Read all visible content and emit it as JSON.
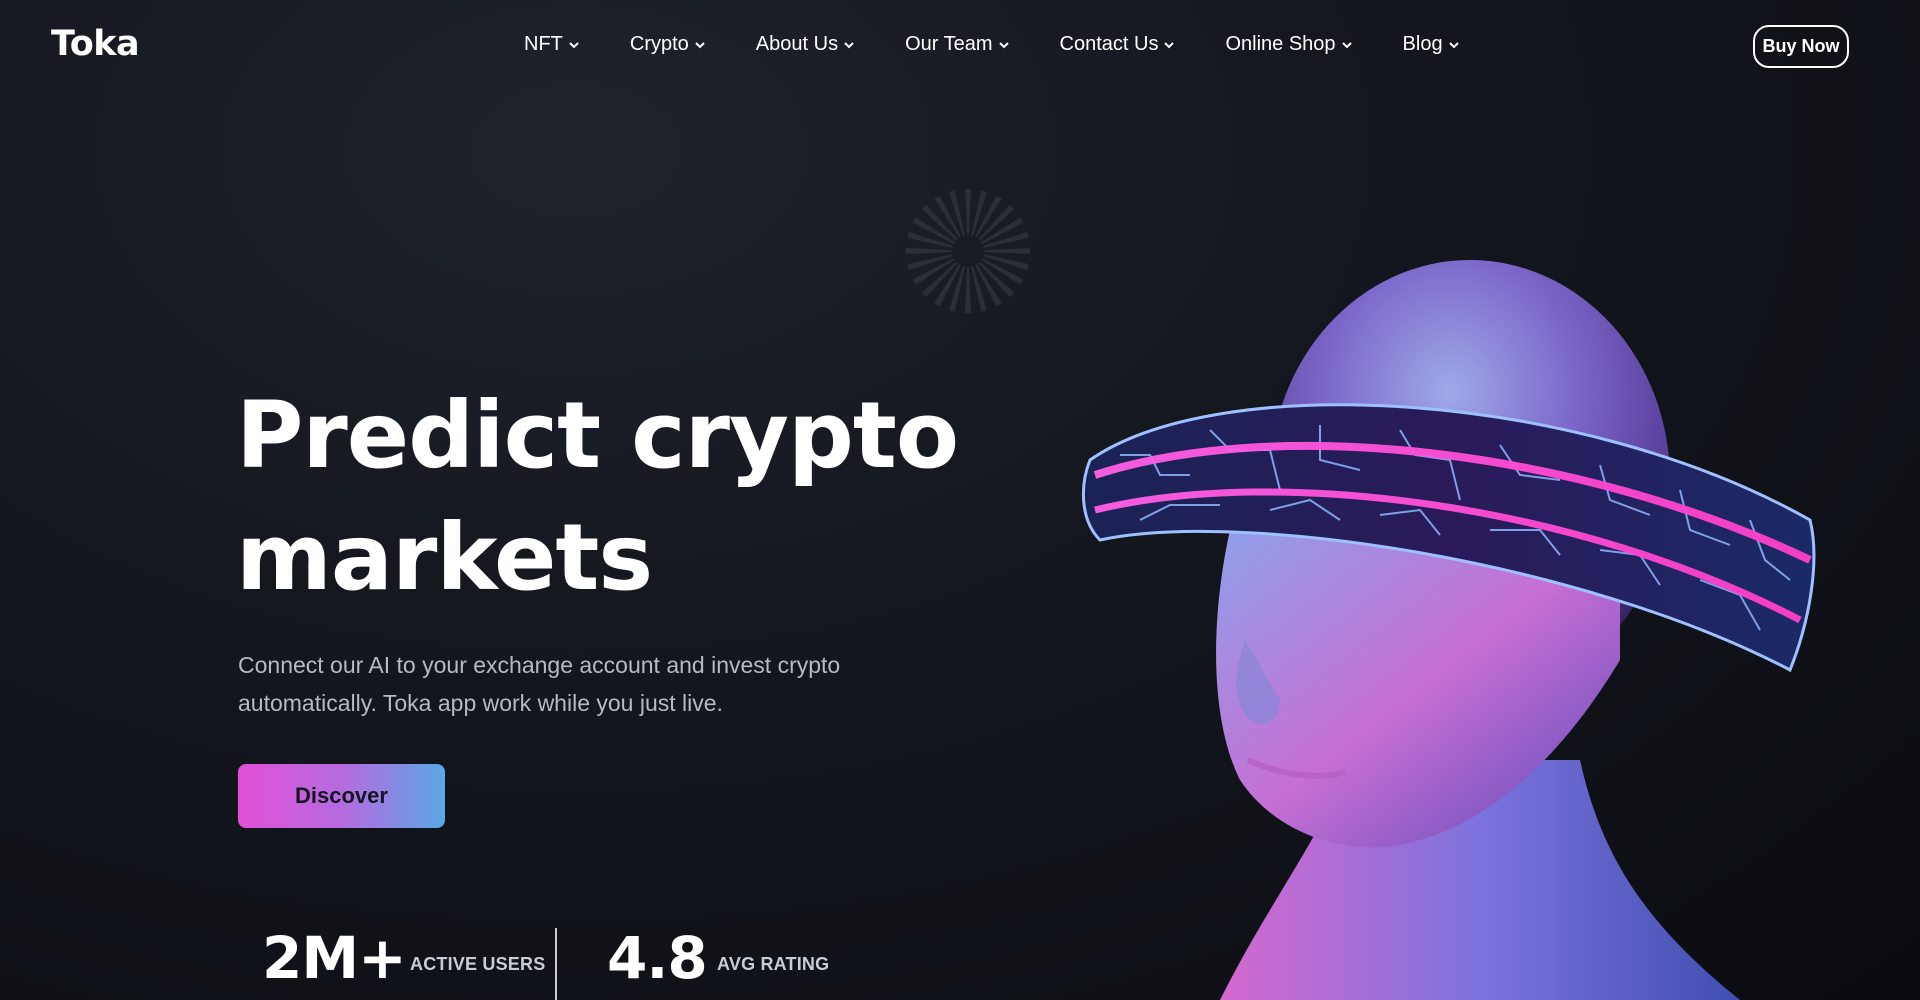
{
  "brand": {
    "name": "Toka"
  },
  "nav": {
    "items": [
      {
        "label": "NFT",
        "icon": "chevron-down-icon"
      },
      {
        "label": "Crypto",
        "icon": "chevron-down-icon"
      },
      {
        "label": "About Us",
        "icon": "chevron-down-icon"
      },
      {
        "label": "Our Team",
        "icon": "chevron-down-icon"
      },
      {
        "label": "Contact Us",
        "icon": "chevron-down-icon"
      },
      {
        "label": "Online Shop",
        "icon": "chevron-down-icon"
      },
      {
        "label": "Blog",
        "icon": "chevron-down-icon"
      }
    ],
    "cta_label": "Buy Now"
  },
  "hero": {
    "title_line1": "Predict crypto",
    "title_line2": "markets",
    "subtitle_line1": "Connect our AI to your exchange account and invest crypto",
    "subtitle_line2": "automatically. Toka app work while you just live.",
    "button_label": "Discover",
    "image_icon": "vr-headset-head-illustration"
  },
  "stats": [
    {
      "value": "2M+",
      "label": "ACTIVE USERS"
    },
    {
      "value": "4.8",
      "label": "AVG RATING"
    }
  ],
  "colors": {
    "background": "#13161d",
    "gradient_start": "#e24fd6",
    "gradient_end": "#5aa7e6",
    "text_muted": "#b6bac4"
  }
}
